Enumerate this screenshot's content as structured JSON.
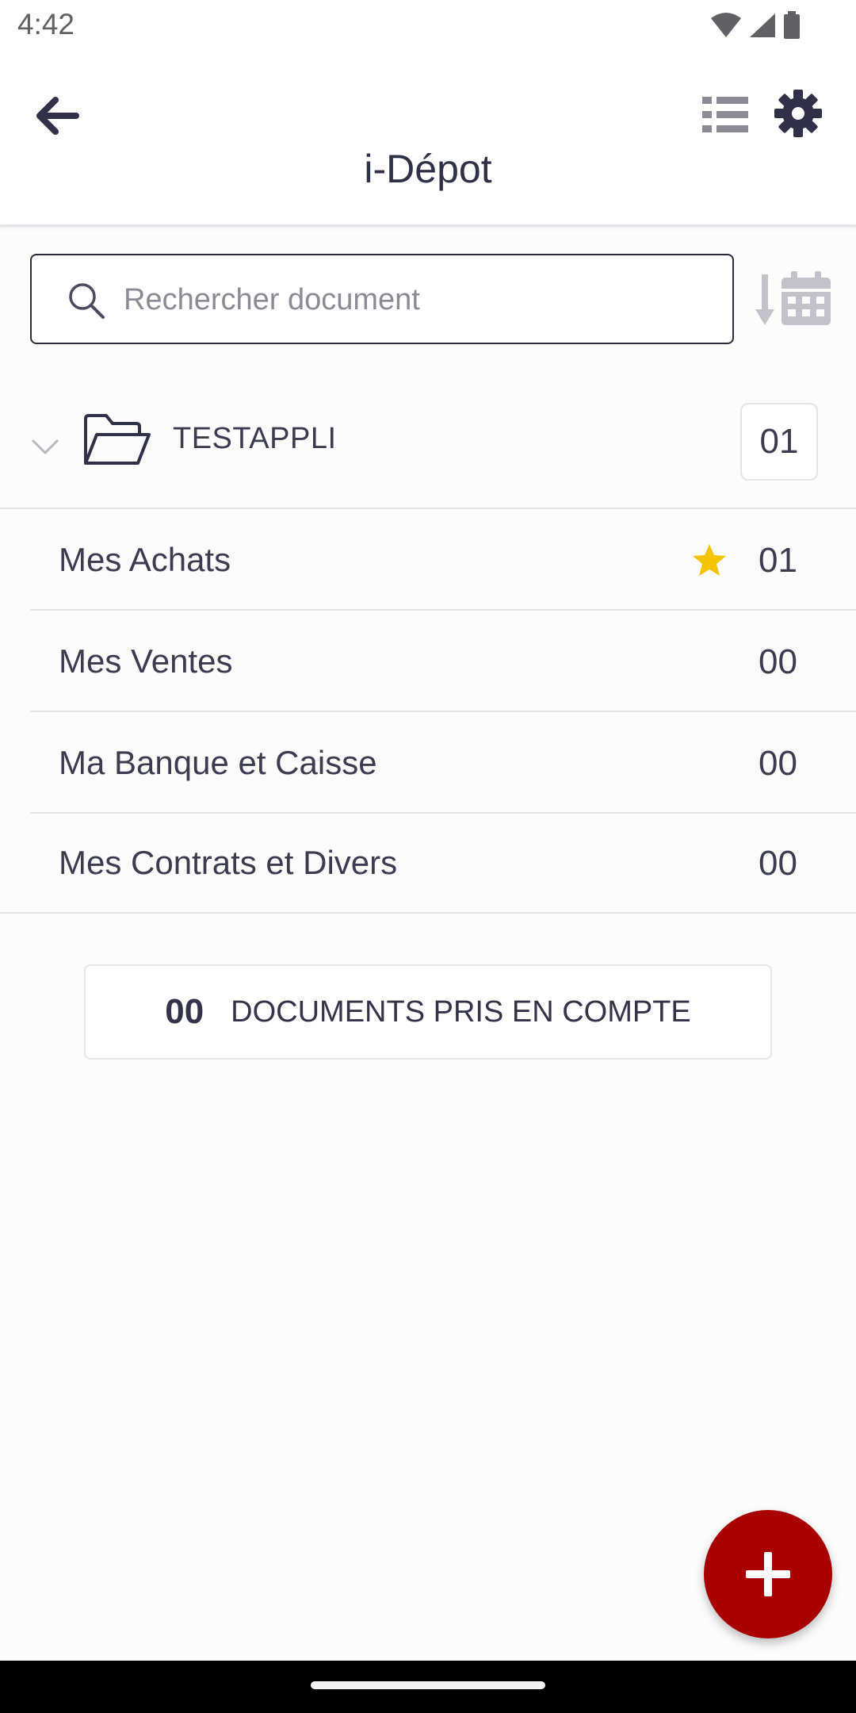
{
  "status_bar": {
    "time": "4:42",
    "icons": [
      "wifi-icon",
      "signal-icon",
      "battery-icon"
    ]
  },
  "header": {
    "title": "i-Dépot",
    "back_icon": "arrow-left-icon",
    "list_icon": "list-icon",
    "settings_icon": "gear-icon"
  },
  "search": {
    "placeholder": "Rechercher document",
    "value": "",
    "sort_icon": "sort-by-date-icon"
  },
  "folder": {
    "name": "TESTAPPLI",
    "count": "01",
    "expanded": true
  },
  "categories": [
    {
      "label": "Mes Achats",
      "count": "01",
      "starred": true
    },
    {
      "label": "Mes Ventes",
      "count": "00",
      "starred": false
    },
    {
      "label": "Ma Banque et Caisse",
      "count": "00",
      "starred": false
    },
    {
      "label": "Mes Contrats et Divers",
      "count": "00",
      "starred": false
    }
  ],
  "summary": {
    "count": "00",
    "label": "DOCUMENTS PRIS EN COMPTE"
  },
  "fab": {
    "icon": "plus-icon"
  },
  "colors": {
    "accent": "#a80000",
    "star": "#f5c400",
    "text": "#33344a",
    "muted_icon": "#8a8b95"
  }
}
